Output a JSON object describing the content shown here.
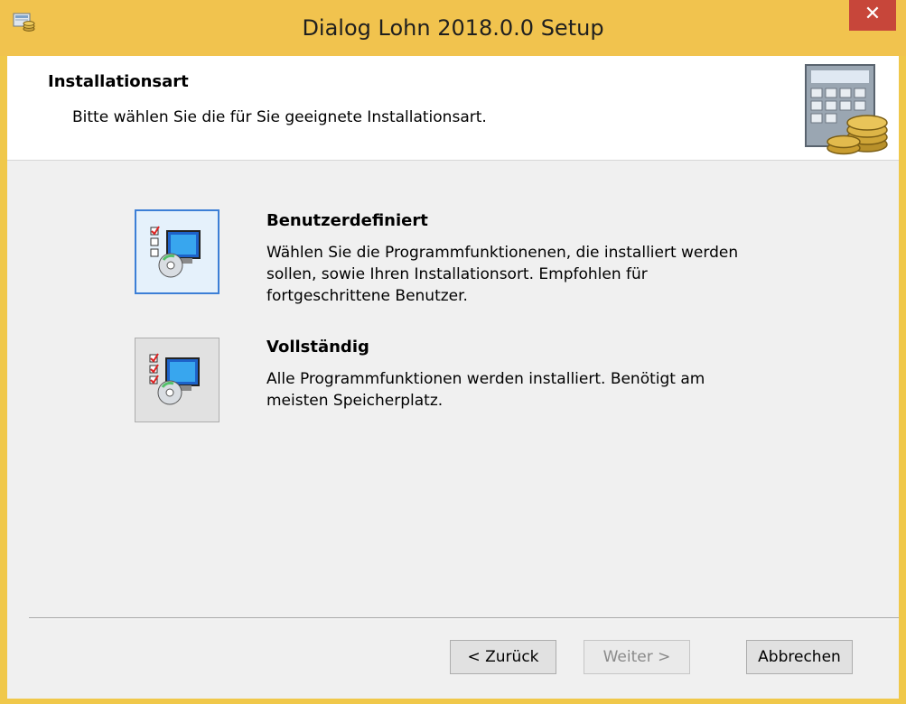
{
  "window": {
    "title": "Dialog Lohn 2018.0.0 Setup",
    "close_glyph": "✕",
    "icon": "setup-app-icon"
  },
  "header": {
    "title": "Installationsart",
    "subtitle": "Bitte wählen Sie die für Sie geeignete Installationsart.",
    "banner_icon": "calculator-coins-icon"
  },
  "options": [
    {
      "title": "Benutzerdefiniert",
      "desc_lines": [
        "Wählen Sie die Programmfunktionenen, die installiert werden",
        "sollen, sowie Ihren Installationsort. Empfohlen für",
        "fortgeschrittene Benutzer."
      ],
      "icon": "custom-install-icon",
      "selected": true
    },
    {
      "title": "Vollständig",
      "desc_lines": [
        "Alle Programmfunktionen werden installiert. Benötigt am",
        "meisten Speicherplatz."
      ],
      "icon": "complete-install-icon",
      "selected": false
    }
  ],
  "buttons": {
    "back": "< Zurück",
    "next": "Weiter >",
    "cancel": "Abbrechen"
  },
  "colors": {
    "titlebar": "#f1c34e",
    "close": "#c7463a",
    "selection_border": "#3c7fd6"
  }
}
